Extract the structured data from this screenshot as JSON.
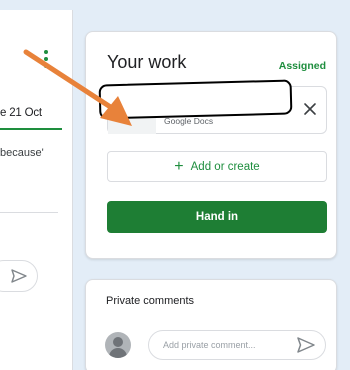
{
  "colors": {
    "accent_green": "#1e8e3e",
    "hand_in_bg": "#1e7e34",
    "annotation_arrow": "#e8823a",
    "page_bg": "#e3edf7"
  },
  "post": {
    "due_text": "e 21 Oct",
    "body_fragment": "because'",
    "menu_icon": "more-vert-icon",
    "send_icon": "send-icon"
  },
  "your_work": {
    "title": "Your work",
    "status": "Assigned",
    "attachment": {
      "type_label": "Google Docs",
      "remove_icon": "close-icon"
    },
    "add_create_icon": "plus-icon",
    "add_create_label": "Add or create",
    "hand_in_label": "Hand in"
  },
  "private_comments": {
    "title": "Private comments",
    "input_placeholder": "Add private comment...",
    "avatar_icon": "user-avatar-icon",
    "send_icon": "send-icon"
  },
  "annotation": {
    "icon": "arrow-annotation-icon"
  }
}
